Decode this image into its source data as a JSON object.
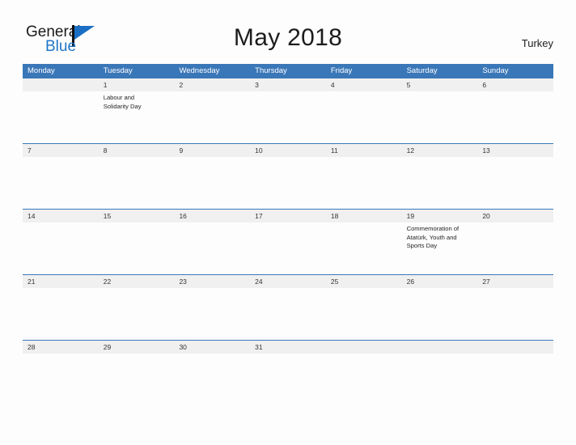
{
  "brand": {
    "name_top": "General",
    "name_bottom": "Blue",
    "color_dark": "#1a1a1a",
    "color_blue": "#1f76c6"
  },
  "header": {
    "title": "May 2018",
    "country": "Turkey"
  },
  "theme": {
    "header_blue": "#3a77b8",
    "date_band_gray": "#f0f0f0",
    "page_background": "#fdfdfd",
    "text_color": "#262626"
  },
  "calendar": {
    "month": "May",
    "year": "2018",
    "weekdays": [
      "Monday",
      "Tuesday",
      "Wednesday",
      "Thursday",
      "Friday",
      "Saturday",
      "Sunday"
    ],
    "weeks": [
      {
        "days": [
          {
            "num": "",
            "events": []
          },
          {
            "num": "1",
            "events": [
              "Labour and",
              "Solidarity Day"
            ]
          },
          {
            "num": "2",
            "events": []
          },
          {
            "num": "3",
            "events": []
          },
          {
            "num": "4",
            "events": []
          },
          {
            "num": "5",
            "events": []
          },
          {
            "num": "6",
            "events": []
          }
        ]
      },
      {
        "days": [
          {
            "num": "7",
            "events": []
          },
          {
            "num": "8",
            "events": []
          },
          {
            "num": "9",
            "events": []
          },
          {
            "num": "10",
            "events": []
          },
          {
            "num": "11",
            "events": []
          },
          {
            "num": "12",
            "events": []
          },
          {
            "num": "13",
            "events": []
          }
        ]
      },
      {
        "days": [
          {
            "num": "14",
            "events": []
          },
          {
            "num": "15",
            "events": []
          },
          {
            "num": "16",
            "events": []
          },
          {
            "num": "17",
            "events": []
          },
          {
            "num": "18",
            "events": []
          },
          {
            "num": "19",
            "events": [
              "Commemoration of",
              "Atatürk, Youth and",
              "Sports Day"
            ]
          },
          {
            "num": "20",
            "events": []
          }
        ]
      },
      {
        "days": [
          {
            "num": "21",
            "events": []
          },
          {
            "num": "22",
            "events": []
          },
          {
            "num": "23",
            "events": []
          },
          {
            "num": "24",
            "events": []
          },
          {
            "num": "25",
            "events": []
          },
          {
            "num": "26",
            "events": []
          },
          {
            "num": "27",
            "events": []
          }
        ]
      },
      {
        "days": [
          {
            "num": "28",
            "events": []
          },
          {
            "num": "29",
            "events": []
          },
          {
            "num": "30",
            "events": []
          },
          {
            "num": "31",
            "events": []
          },
          {
            "num": "",
            "events": []
          },
          {
            "num": "",
            "events": []
          },
          {
            "num": "",
            "events": []
          }
        ]
      }
    ]
  }
}
